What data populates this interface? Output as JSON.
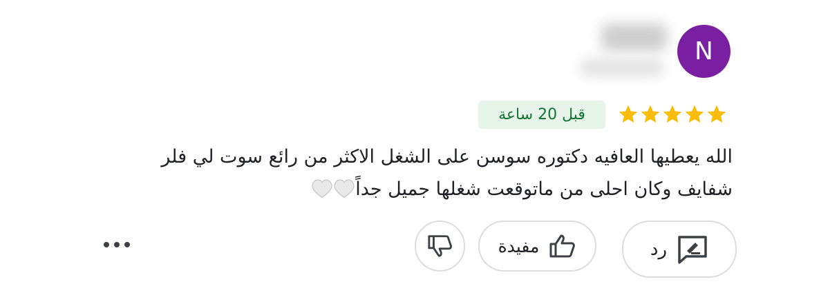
{
  "reviewer": {
    "avatar_letter": "N",
    "avatar_color": "#7b1fa2"
  },
  "rating": {
    "stars": 5,
    "max": 5,
    "star_color": "#fbbc04"
  },
  "time_badge": "قبل 20 ساعة",
  "review": {
    "line1": "الله يعطيها العافيه دكتوره سوسن على الشغل الاكثر من رائع سوت لي فلر",
    "line2": "شفايف وكان احلى من ماتوقعت شغلها جميل جداً"
  },
  "actions": {
    "reply_label": "رد",
    "helpful_label": "مفيدة",
    "icons": [
      "reply-icon",
      "thumbs-up-icon",
      "thumbs-down-icon",
      "more-icon"
    ]
  }
}
